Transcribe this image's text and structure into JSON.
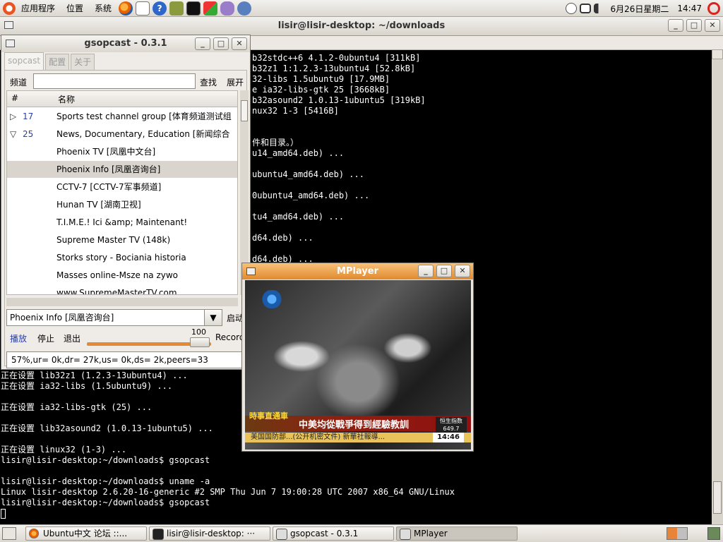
{
  "top_panel": {
    "menus": [
      "应用程序",
      "位置",
      "系统"
    ],
    "clock": "14:47",
    "date": "6月26日星期二"
  },
  "terminal": {
    "title": "lisir@lisir-desktop: ~/downloads",
    "lines": [
      {
        "text": "b32stdc++6 4.1.2-0ubuntu4 [311kB]"
      },
      {
        "text": "b32z1 1:1.2.3-13ubuntu4 [52.8kB]"
      },
      {
        "text": "32-libs 1.5ubuntu9 [17.9MB]"
      },
      {
        "text": "e ia32-libs-gtk 25 [3668kB]"
      },
      {
        "text": "b32asound2 1.0.13-1ubuntu5 [319kB]"
      },
      {
        "text": "nux32 1-3 [5416B]"
      },
      {
        "text": "件和目录。）"
      },
      {
        "text": "u14_amd64.deb) ..."
      },
      {
        "text": "ubuntu4_amd64.deb) ..."
      },
      {
        "text": "0ubuntu4_amd64.deb) ..."
      },
      {
        "text": "tu4_amd64.deb) ..."
      },
      {
        "text": "d64.deb) ..."
      },
      {
        "text": "d64.deb) ..."
      },
      {
        "text": "正在设置 lib32z1 (1.2.3-13ubuntu4) ..."
      },
      {
        "text": "正在设置 ia32-libs (1.5ubuntu9) ..."
      },
      {
        "text": "正在设置 ia32-libs-gtk (25) ..."
      },
      {
        "text": "正在设置 lib32asound2 (1.0.13-1ubuntu5) ..."
      },
      {
        "text": "正在设置 linux32 (1-3) ..."
      },
      {
        "text": "lisir@lisir-desktop:~/downloads$ gsopcast"
      },
      {
        "text": "lisir@lisir-desktop:~/downloads$ uname -a"
      },
      {
        "text": "Linux lisir-desktop 2.6.20-16-generic #2 SMP Thu Jun 7 19:00:28 UTC 2007 x86_64 GNU/Linux"
      },
      {
        "text": "lisir@lisir-desktop:~/downloads$ gsopcast"
      }
    ]
  },
  "gsopcast": {
    "title": "gsopcast - 0.3.1",
    "tabs": [
      "sopcast",
      "配置",
      "关于"
    ],
    "channel_label": "频道",
    "search_button": "查找",
    "expand_button": "展开",
    "columns": [
      "#",
      "名称"
    ],
    "channels": [
      {
        "num": "17",
        "name": "Sports test channel group [体育频道测试组",
        "expander": "▷"
      },
      {
        "num": "25",
        "name": "News, Documentary, Education [新闻综合",
        "expander": "▽"
      },
      {
        "num": "",
        "name": "Phoenix TV [凤凰中文台]",
        "expander": ""
      },
      {
        "num": "",
        "name": "Phoenix Info [凤凰咨询台]",
        "expander": ""
      },
      {
        "num": "",
        "name": "CCTV-7 [CCTV-7军事频道]",
        "expander": ""
      },
      {
        "num": "",
        "name": "Hunan TV [湖南卫视]",
        "expander": ""
      },
      {
        "num": "",
        "name": "T.I.M.E.! Ici &amp; Maintenant!",
        "expander": ""
      },
      {
        "num": "",
        "name": "Supreme Master TV (148k)",
        "expander": ""
      },
      {
        "num": "",
        "name": "Storks story - Bociania historia",
        "expander": ""
      },
      {
        "num": "",
        "name": "Masses online-Msze na zywo",
        "expander": ""
      },
      {
        "num": "",
        "name": "www.SupremeMasterTV.com",
        "expander": ""
      }
    ],
    "selected_channel": "Phoenix Info [凤凰咨询台]",
    "start_button": "启动",
    "play_button": "播放",
    "stop_button": "停止",
    "quit_button": "退出",
    "volume_value": "100",
    "record_button": "Record",
    "status": "57%,ur=  0k,dr= 27k,us=  0k,ds=  2k,peers=33"
  },
  "mplayer": {
    "title": "MPlayer",
    "video": {
      "ticker_text": "中美均從戰爭得到經驗教訓",
      "ticker_label": "時事直通車",
      "ticker_bottom": "美国国防部...(公开机密文件)  新華社報導...",
      "stock_label": "恒生指数",
      "stock_value": "649.7",
      "clock": "14:46"
    }
  },
  "taskbar": {
    "tasks": [
      {
        "label": "Ubuntu中文 论坛 ::..."
      },
      {
        "label": "lisir@lisir-desktop: ···"
      },
      {
        "label": "gsopcast - 0.3.1"
      },
      {
        "label": "MPlayer"
      }
    ]
  }
}
